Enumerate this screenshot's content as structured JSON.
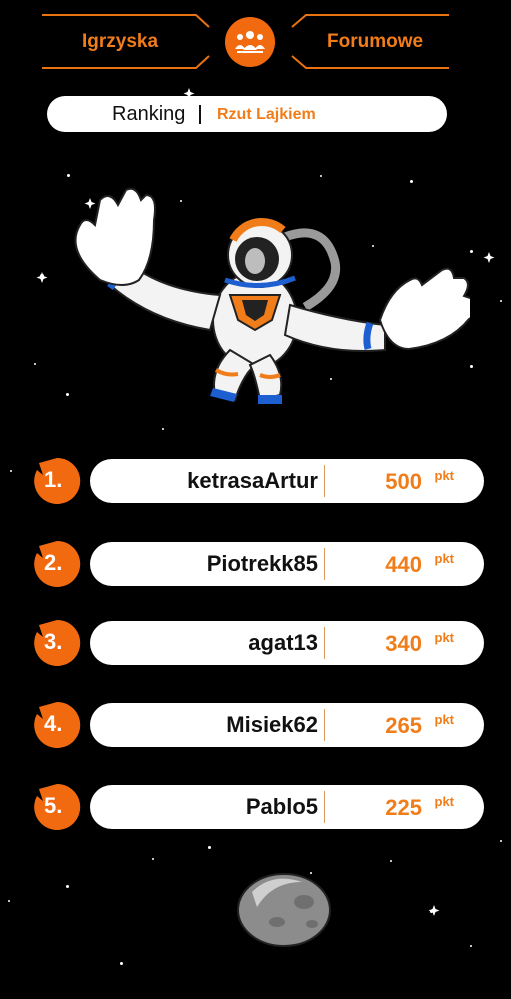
{
  "header": {
    "left_word": "Igrzyska",
    "right_word": "Forumowe",
    "logo_icon": "people-group-icon",
    "accent": "#f26a10"
  },
  "ranking": {
    "title": "Ranking",
    "separator": "|",
    "subtitle": "Rzut Lajkiem"
  },
  "leaderboard": [
    {
      "rank": "1.",
      "name": "ketrasaArtur",
      "points": "500",
      "unit": "pkt"
    },
    {
      "rank": "2.",
      "name": "Piotrekk85",
      "points": "440",
      "unit": "pkt"
    },
    {
      "rank": "3.",
      "name": "agat13",
      "points": "340",
      "unit": "pkt"
    },
    {
      "rank": "4.",
      "name": "Misiek62",
      "points": "265",
      "unit": "pkt"
    },
    {
      "rank": "5.",
      "name": "Pablo5",
      "points": "225",
      "unit": "pkt"
    }
  ]
}
